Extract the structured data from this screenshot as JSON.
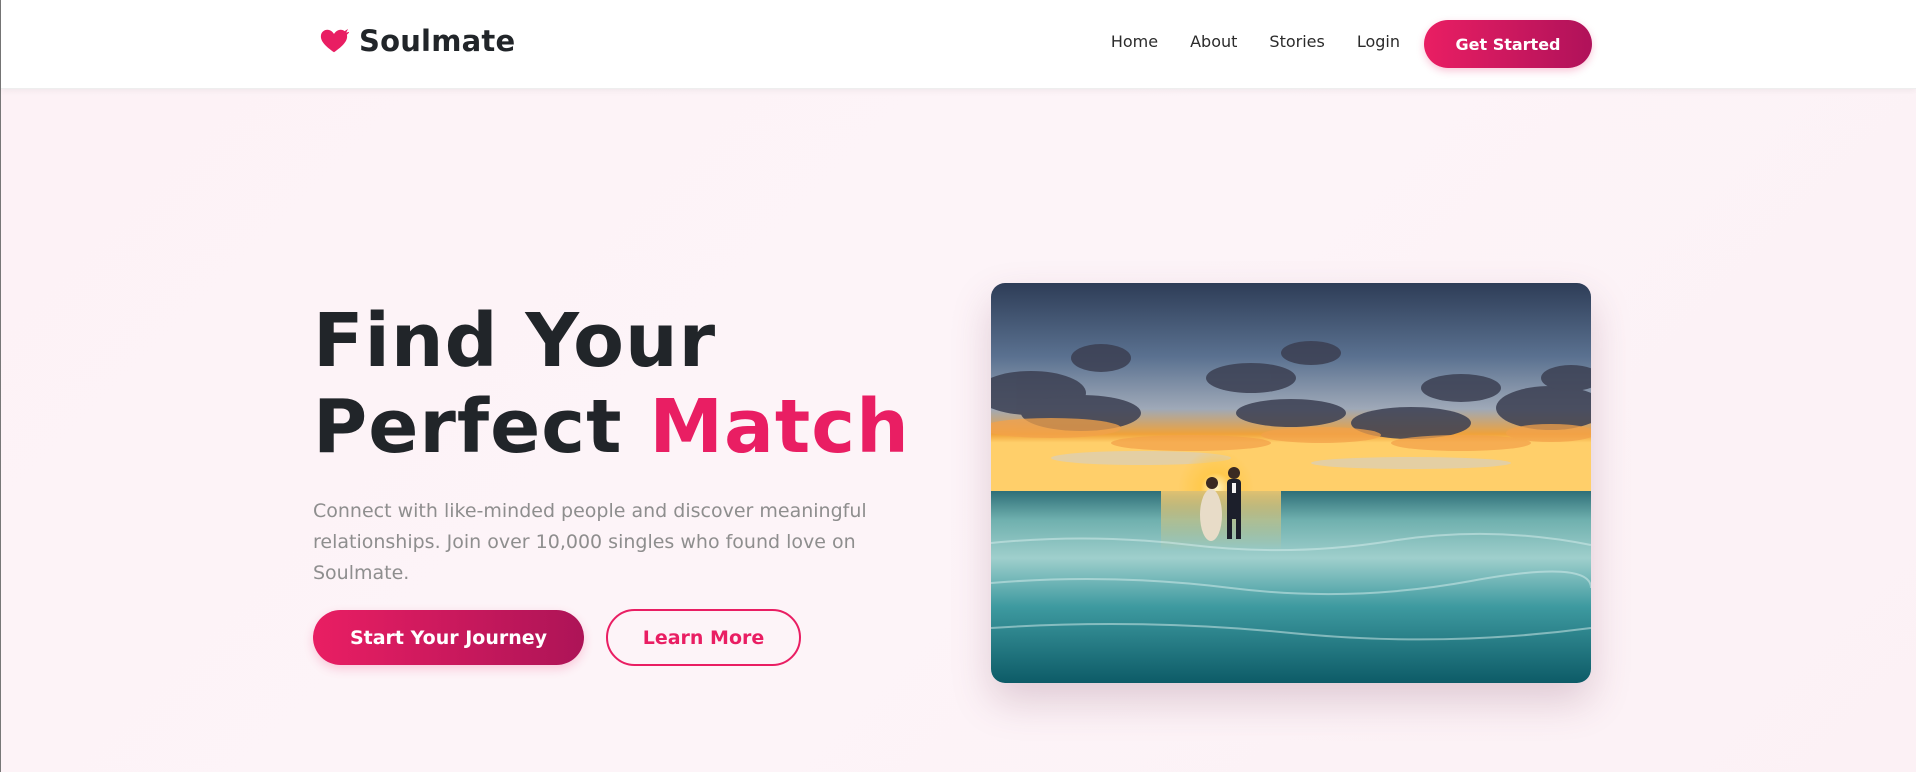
{
  "brand": {
    "name": "Soulmate",
    "icon": "heart-wing-icon",
    "accent_color": "#e91e63"
  },
  "nav": {
    "links": [
      "Home",
      "About",
      "Stories",
      "Login"
    ],
    "cta_label": "Get Started"
  },
  "hero": {
    "title_line1": "Find Your",
    "title_line2_plain": "Perfect ",
    "title_line2_accent": "Match",
    "subtitle": "Connect with like-minded people and discover meaningful relationships. Join over 10,000 singles who found love on Soulmate.",
    "primary_button": "Start Your Journey",
    "secondary_button": "Learn More",
    "image_alt": "couple-walking-on-beach-at-sunset"
  },
  "colors": {
    "accent": "#e91e63",
    "accent_dark": "#ad1457",
    "text_dark": "#212529",
    "text_muted": "#8e8e8e",
    "background": "#fdf2f6"
  }
}
